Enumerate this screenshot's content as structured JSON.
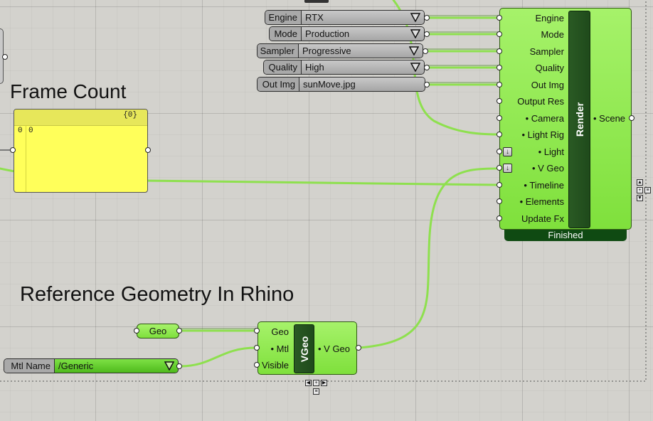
{
  "headings": {
    "frame_count": "Frame Count",
    "reference_geometry": "Reference Geometry In Rhino"
  },
  "selectors": [
    {
      "label": "Engine",
      "value": "RTX"
    },
    {
      "label": "Mode",
      "value": "Production"
    },
    {
      "label": "Sampler",
      "value": "Progressive"
    },
    {
      "label": "Quality",
      "value": "High"
    }
  ],
  "out_img": {
    "label": "Out Img",
    "value": "sunMove.jpg"
  },
  "panel": {
    "path": "{0}",
    "row_index": "0",
    "row_value": "0"
  },
  "render": {
    "title": "Render",
    "inputs": [
      "Engine",
      "Mode",
      "Sampler",
      "Quality",
      "Out Img",
      "Output Res",
      "• Camera",
      "• Light Rig",
      "• Light",
      "• V Geo",
      "• Timeline",
      "• Elements",
      "Update Fx"
    ],
    "output": "• Scene",
    "status": "Finished"
  },
  "geo_param": {
    "label": "Geo"
  },
  "mtl_name": {
    "label": "Mtl Name",
    "value": "/Generic"
  },
  "vgeo": {
    "title": "VGeo",
    "inputs": [
      "Geo",
      "• Mtl",
      "Visible"
    ],
    "output": "• V Geo"
  },
  "colors": {
    "canvas": "#d3d2cd",
    "component_green": "#8ee84c",
    "wire_green": "#8ee04e",
    "panel_yellow": "#ffff5a",
    "status_bar": "#0f4a12"
  }
}
